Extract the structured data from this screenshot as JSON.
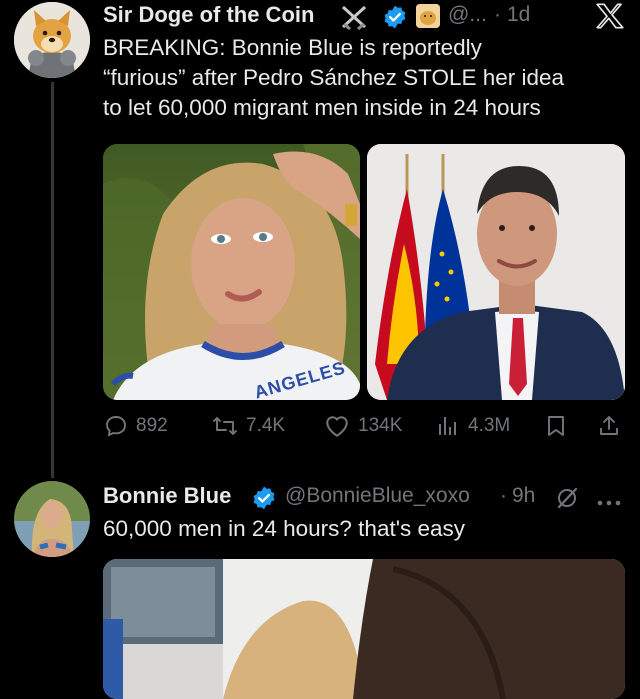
{
  "tweet1": {
    "author_name": "Sir Doge of the Coin",
    "handle": "@...",
    "sep": "·",
    "time": "1d",
    "text_lines": [
      "BREAKING: Bonnie Blue is reportedly",
      "“furious” after Pedro Sánchez STOLE her idea",
      "to let 60,000 migrant men inside in 24 hours"
    ],
    "image_left_overlay_text": "ANGELES",
    "stats": {
      "replies": "892",
      "reposts": "7.4K",
      "likes": "134K",
      "views": "4.3M"
    }
  },
  "tweet2": {
    "author_name": "Bonnie Blue",
    "handle": "@BonnieBlue_xoxo",
    "sep": "·",
    "time": "9h",
    "text": "60,000 men in 24 hours? that's easy"
  },
  "colors": {
    "background": "#000000",
    "text": "#e7e9ea",
    "muted": "#71767b",
    "verified": "#1d9bf0",
    "spain_red": "#c60b1e",
    "spain_yellow": "#ffc400",
    "eu_blue": "#003399"
  },
  "icons": {
    "close": "x-logo-icon",
    "verified": "verified-badge-icon",
    "reply": "reply-icon",
    "repost": "repost-icon",
    "like": "heart-icon",
    "views": "views-icon",
    "bookmark": "bookmark-icon",
    "share": "share-icon",
    "more": "more-icon",
    "grok": "grok-icon"
  }
}
